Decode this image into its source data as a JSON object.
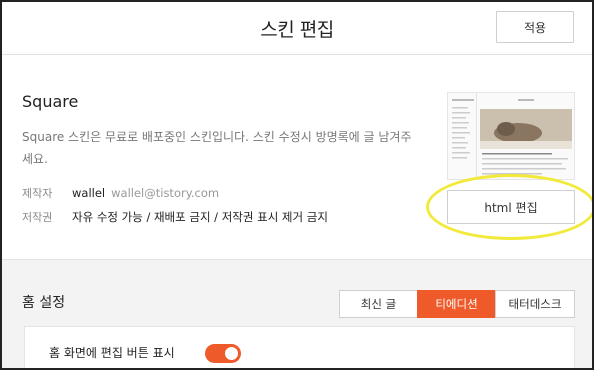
{
  "header": {
    "title": "스킨 편집",
    "apply_label": "적용"
  },
  "skin": {
    "name": "Square",
    "description": "Square 스킨은 무료로 배포중인 스킨입니다. 스킨 수정시 방명록에 글 남겨주세요.",
    "maker_label": "제작자",
    "maker_name": "wallel",
    "maker_email": "wallel@tistory.com",
    "copyright_label": "저작권",
    "copyright_value": "자유 수정 가능 / 재배포 금지 / 저작권 표시 제거 금지",
    "html_edit_label": "html 편집",
    "highlight_color": "#f2ea3a"
  },
  "home": {
    "title": "홈 설정",
    "tabs": [
      {
        "label": "최신 글",
        "active": false
      },
      {
        "label": "티에디션",
        "active": true
      },
      {
        "label": "태터데스크",
        "active": false
      }
    ],
    "toggle_label": "홈 화면에 편집 버튼 표시",
    "toggle_on": true,
    "accent_color": "#ef5a2a"
  }
}
